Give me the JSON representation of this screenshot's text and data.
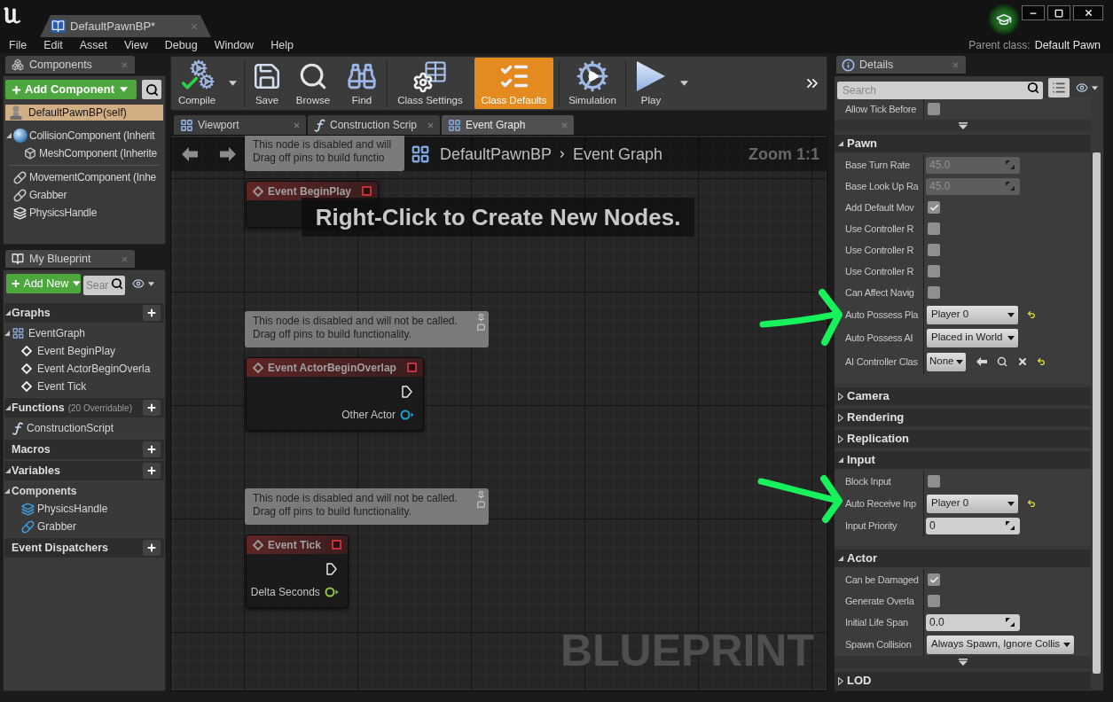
{
  "title_bar": {
    "document_tab": "DefaultPawnBP*",
    "parent_class_label": "Parent class:",
    "parent_class_value": "Default Pawn"
  },
  "menu": [
    "File",
    "Edit",
    "Asset",
    "View",
    "Debug",
    "Window",
    "Help"
  ],
  "components_panel": {
    "tab": "Components",
    "add_button": "Add Component",
    "root": {
      "label": "DefaultPawnBP(self)",
      "kind": "self",
      "selected": true
    },
    "scene_components": [
      {
        "label": "CollisionComponent (Inherit",
        "kind": "sphere",
        "selected": false,
        "expanded": true,
        "children": [
          {
            "label": "MeshComponent (Inherite",
            "kind": "mesh",
            "selected": false
          }
        ]
      }
    ],
    "actor_components": [
      {
        "label": "MovementComponent (Inhe",
        "kind": "capsule",
        "selected": false
      },
      {
        "label": "Grabber",
        "kind": "capsule",
        "selected": false
      },
      {
        "label": "PhysicsHandle",
        "kind": "handle",
        "selected": false
      }
    ]
  },
  "my_blueprint": {
    "tab": "My Blueprint",
    "add_button": "Add New",
    "search": {
      "placeholder": "Sear"
    },
    "sections": [
      {
        "title": "Graphs",
        "expanded": true,
        "items": [
          {
            "label": "EventGraph",
            "kind": "graph",
            "selected": false,
            "expanded": true,
            "children": [
              {
                "label": "Event BeginPlay",
                "kind": "event",
                "selected": false
              },
              {
                "label": "Event ActorBeginOverla",
                "kind": "event",
                "selected": false
              },
              {
                "label": "Event Tick",
                "kind": "event",
                "selected": false
              }
            ]
          }
        ]
      },
      {
        "title": "Functions",
        "note": "(20 Overridable)",
        "expanded": true,
        "items": [
          {
            "label": "ConstructionScript",
            "kind": "function",
            "selected": false
          }
        ]
      },
      {
        "title": "Macros"
      },
      {
        "title": "Variables",
        "expanded": true,
        "items": [
          {
            "label": "Components",
            "kind": "group",
            "selected": false,
            "expanded": true,
            "children": [
              {
                "label": "PhysicsHandle",
                "kind": "handle",
                "selected": false
              },
              {
                "label": "Grabber",
                "kind": "capsule",
                "selected": false
              }
            ]
          }
        ]
      },
      {
        "title": "Event Dispatchers"
      }
    ]
  },
  "toolbar": {
    "groups": [
      [
        {
          "label": "Compile",
          "kind": "compile",
          "active": false,
          "dropdown": true
        }
      ],
      [
        {
          "label": "Save",
          "kind": "save",
          "active": false,
          "dropdown": false
        },
        {
          "label": "Browse",
          "kind": "browse",
          "active": false,
          "dropdown": false
        },
        {
          "label": "Find",
          "kind": "find",
          "active": false,
          "dropdown": false
        }
      ],
      [
        {
          "label": "Class Settings",
          "kind": "class_settings",
          "active": false,
          "dropdown": false
        },
        {
          "label": "Class Defaults",
          "kind": "class_defaults",
          "active": true,
          "dropdown": false
        }
      ],
      [
        {
          "label": "Simulation",
          "kind": "simulation",
          "active": false,
          "dropdown": false
        }
      ],
      [
        {
          "label": "Play",
          "kind": "play",
          "active": false,
          "dropdown": true
        }
      ]
    ]
  },
  "graph_tabs": [
    {
      "label": "Viewport",
      "kind": "viewport",
      "selected": false
    },
    {
      "label": "Construction Scrip",
      "kind": "function",
      "selected": false
    },
    {
      "label": "Event Graph",
      "kind": "graph",
      "selected": true
    }
  ],
  "graph": {
    "breadcrumb": [
      "DefaultPawnBP",
      "Event Graph"
    ],
    "zoom": "Zoom 1:1",
    "hint": "Right-Click to Create New Nodes.",
    "watermark": "BLUEPRINT",
    "nodes": [
      {
        "title": "Event BeginPlay",
        "comment": [
          "This node is disabled and will",
          "Drag off pins to build functio"
        ]
      },
      {
        "title": "Event ActorBeginOverlap",
        "comment": [
          "This node is disabled and will not be called.",
          "Drag off pins to build functionality."
        ],
        "exec": true,
        "pins": [
          {
            "label": "Other Actor",
            "color": "#1e9fd8"
          }
        ]
      },
      {
        "title": "Event Tick",
        "comment": [
          "This node is disabled and will not be called.",
          "Drag off pins to build functionality."
        ],
        "exec": true,
        "pins": [
          {
            "label": "Delta Seconds",
            "color": "#8dc63f"
          }
        ]
      }
    ]
  },
  "details": {
    "tab": "Details",
    "search": {
      "placeholder": "Search"
    },
    "top_rows": [
      {
        "label": "Allow Tick Before",
        "kind": "checkbox",
        "checked": false
      }
    ],
    "top_advanced_expanded": false,
    "categories": [
      {
        "title": "Pawn",
        "expanded": true,
        "rows": [
          {
            "label": "Base Turn Rate",
            "kind": "number",
            "value": "45.0",
            "disabled": true
          },
          {
            "label": "Base Look Up Ra",
            "kind": "number",
            "value": "45.0",
            "disabled": true
          },
          {
            "label": "Add Default Mov",
            "kind": "checkbox",
            "checked": true
          },
          {
            "label": "Use Controller R",
            "kind": "checkbox",
            "checked": false
          },
          {
            "label": "Use Controller R",
            "kind": "checkbox",
            "checked": false
          },
          {
            "label": "Use Controller R",
            "kind": "checkbox",
            "checked": false
          },
          {
            "label": "Can Affect Navig",
            "kind": "checkbox",
            "checked": false
          },
          {
            "label": "Auto Possess Pla",
            "kind": "dropdown",
            "value": "Player 0",
            "reset": true
          },
          {
            "label": "Auto Possess AI",
            "kind": "dropdown",
            "value": "Placed in World",
            "reset": false
          },
          {
            "label": "AI Controller Clas",
            "kind": "class",
            "value": "None",
            "reset": true
          }
        ]
      },
      {
        "title": "Camera",
        "expanded": false
      },
      {
        "title": "Rendering",
        "expanded": false
      },
      {
        "title": "Replication",
        "expanded": false
      },
      {
        "title": "Input",
        "expanded": true,
        "rows": [
          {
            "label": "Block Input",
            "kind": "checkbox",
            "checked": false
          },
          {
            "label": "Auto Receive Inp",
            "kind": "dropdown",
            "value": "Player 0",
            "reset": true
          },
          {
            "label": "Input Priority",
            "kind": "number",
            "value": "0",
            "disabled": false
          }
        ]
      },
      {
        "title": "Actor",
        "expanded": true,
        "advanced_expanded": false,
        "rows": [
          {
            "label": "Can be Damaged",
            "kind": "checkbox",
            "checked": true
          },
          {
            "label": "Generate Overla",
            "kind": "checkbox",
            "checked": false
          },
          {
            "label": "Initial Life Span",
            "kind": "number",
            "value": "0.0",
            "disabled": false
          },
          {
            "label": "Spawn Collision",
            "kind": "dropdown",
            "value": "Always Spawn, Ignore Collis",
            "reset": false
          }
        ]
      },
      {
        "title": "LOD",
        "expanded": false
      }
    ]
  }
}
